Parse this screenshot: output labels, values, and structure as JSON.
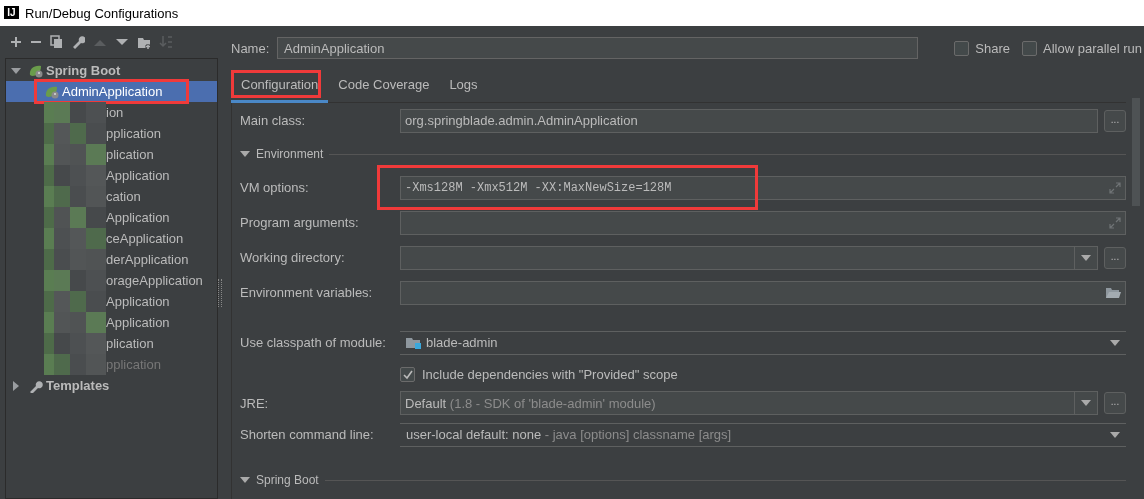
{
  "window": {
    "icon_text": "IJ",
    "title": "Run/Debug Configurations"
  },
  "toolbar": [
    {
      "kind": "add",
      "disabled": false
    },
    {
      "kind": "remove",
      "disabled": false
    },
    {
      "kind": "copy",
      "disabled": false
    },
    {
      "kind": "wrench",
      "disabled": false
    },
    {
      "kind": "up",
      "disabled": true
    },
    {
      "kind": "down",
      "disabled": false
    },
    {
      "kind": "folder",
      "disabled": false
    },
    {
      "kind": "sort",
      "disabled": true
    }
  ],
  "tree": [
    {
      "kind": "spring",
      "label": "Spring Boot",
      "expanded": true,
      "children": [
        {
          "label": "AdminApplication",
          "selected": true,
          "disabled": false,
          "redacted": false,
          "annotated": true
        },
        {
          "label": "ion",
          "selected": false,
          "disabled": false,
          "redacted": true,
          "annotated": false
        },
        {
          "label": "pplication",
          "selected": false,
          "disabled": false,
          "redacted": true,
          "annotated": false
        },
        {
          "label": "plication",
          "selected": false,
          "disabled": false,
          "redacted": true,
          "annotated": false
        },
        {
          "label": "Application",
          "selected": false,
          "disabled": false,
          "redacted": true,
          "annotated": false
        },
        {
          "label": "cation",
          "selected": false,
          "disabled": false,
          "redacted": true,
          "annotated": false
        },
        {
          "label": "Application",
          "selected": false,
          "disabled": false,
          "redacted": true,
          "annotated": false
        },
        {
          "label": "ceApplication",
          "selected": false,
          "disabled": false,
          "redacted": true,
          "annotated": false
        },
        {
          "label": "derApplication",
          "selected": false,
          "disabled": false,
          "redacted": true,
          "annotated": false
        },
        {
          "label": "orageApplication",
          "selected": false,
          "disabled": false,
          "redacted": true,
          "annotated": false
        },
        {
          "label": "Application",
          "selected": false,
          "disabled": false,
          "redacted": true,
          "annotated": false
        },
        {
          "label": "Application",
          "selected": false,
          "disabled": false,
          "redacted": true,
          "annotated": false
        },
        {
          "label": "plication",
          "selected": false,
          "disabled": false,
          "redacted": true,
          "annotated": false
        },
        {
          "label": "pplication",
          "selected": false,
          "disabled": true,
          "redacted": true,
          "annotated": false
        }
      ]
    },
    {
      "kind": "templates",
      "label": "Templates",
      "expanded": false
    }
  ],
  "name": {
    "label": "Name:",
    "value": "AdminApplication"
  },
  "options": [
    {
      "label": "Share",
      "checked": false
    },
    {
      "label": "Allow parallel run",
      "checked": false
    }
  ],
  "tabs": [
    {
      "label": "Configuration",
      "selected": true,
      "annotated": true
    },
    {
      "label": "Code Coverage",
      "selected": false,
      "annotated": false
    },
    {
      "label": "Logs",
      "selected": false,
      "annotated": false
    }
  ],
  "form": [
    {
      "kind": "text",
      "label": "Main class:",
      "value": "org.springblade.admin.AdminApplication",
      "browse": "..."
    },
    {
      "kind": "section",
      "label": "Environment",
      "expanded": true
    },
    {
      "kind": "expandable",
      "label": "VM options:",
      "value": "-Xms128M -Xmx512M -XX:MaxNewSize=128M",
      "monospace": true,
      "annotated": true
    },
    {
      "kind": "expandable",
      "label": "Program arguments:",
      "annotated": false
    },
    {
      "kind": "combo",
      "label": "Working directory:",
      "browse": "..."
    },
    {
      "kind": "folder",
      "label": "Environment variables:"
    },
    {
      "kind": "module",
      "label": "Use classpath of module:",
      "value": "blade-admin"
    },
    {
      "kind": "checkbox",
      "label": "Include dependencies with \"Provided\" scope",
      "checked": true
    },
    {
      "kind": "combo",
      "label": "JRE:",
      "value": "Default",
      "detail": "(1.8 - SDK of 'blade-admin' module)",
      "browse": "..."
    },
    {
      "kind": "select",
      "label": "Shorten command line:",
      "value": "user-local default: none",
      "detail": "- java [options] classname [args]"
    },
    {
      "kind": "section",
      "label": "Spring Boot",
      "expanded": true
    }
  ]
}
